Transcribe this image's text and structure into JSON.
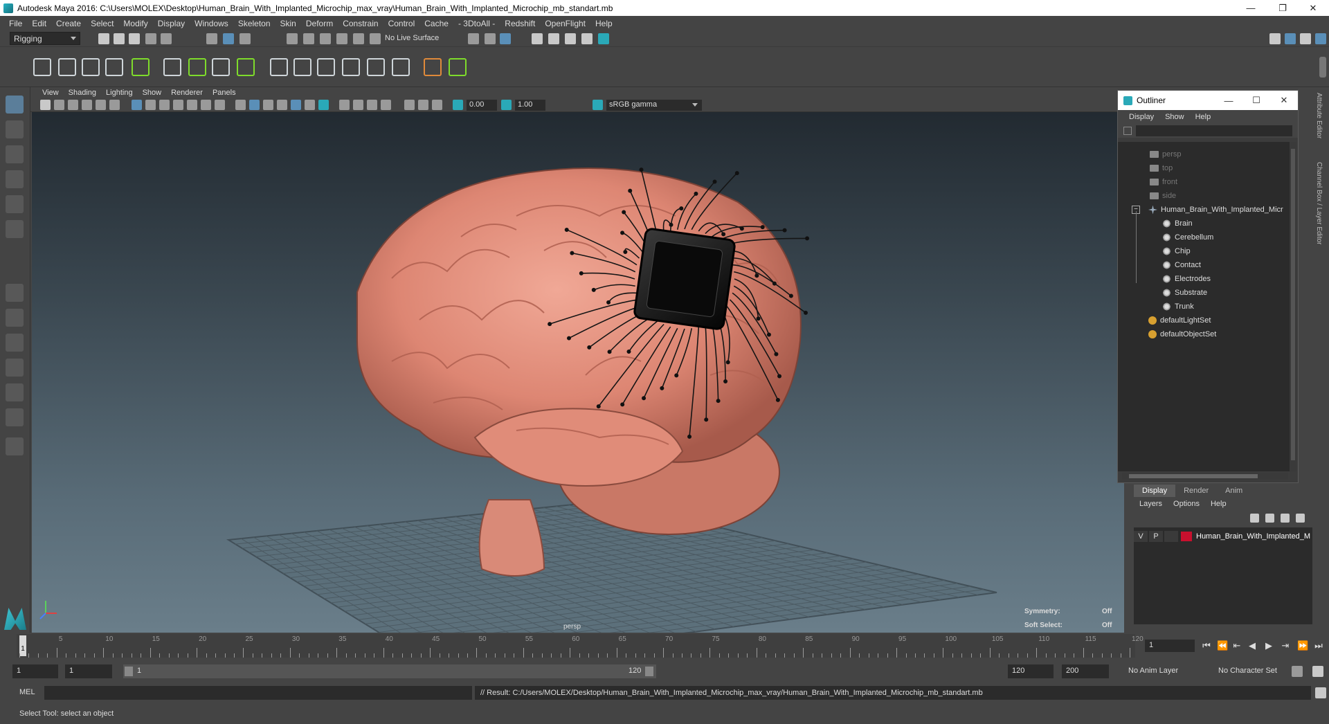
{
  "window": {
    "title": "Autodesk Maya 2016: C:\\Users\\MOLEX\\Desktop\\Human_Brain_With_Implanted_Microchip_max_vray\\Human_Brain_With_Implanted_Microchip_mb_standart.mb",
    "minimize": "—",
    "restore": "❐",
    "close": "✕"
  },
  "menubar": [
    "File",
    "Edit",
    "Create",
    "Select",
    "Modify",
    "Display",
    "Windows",
    "Skeleton",
    "Skin",
    "Deform",
    "Constrain",
    "Control",
    "Cache",
    "- 3DtoAll -",
    "Redshift",
    "OpenFlight",
    "Help"
  ],
  "status_line": {
    "mode": "Rigging",
    "live_surface": "No Live Surface"
  },
  "viewport": {
    "menus": [
      "View",
      "Shading",
      "Lighting",
      "Show",
      "Renderer",
      "Panels"
    ],
    "exposure": "0.00",
    "gamma_value": "1.00",
    "color_space": "sRGB gamma",
    "camera_label": "persp",
    "hud": {
      "symmetry_label": "Symmetry:",
      "symmetry_value": "Off",
      "soft_select_label": "Soft Select:",
      "soft_select_value": "Off"
    }
  },
  "outliner": {
    "title": "Outliner",
    "menus": [
      "Display",
      "Show",
      "Help"
    ],
    "cameras": [
      "persp",
      "top",
      "front",
      "side"
    ],
    "group": "Human_Brain_With_Implanted_Micr",
    "children": [
      "Brain",
      "Cerebellum",
      "Chip",
      "Contact",
      "Electrodes",
      "Substrate",
      "Trunk"
    ],
    "sets": [
      "defaultLightSet",
      "defaultObjectSet"
    ]
  },
  "right_strip": {
    "attribute_editor": "Attribute Editor",
    "channel_box": "Channel Box / Layer Editor"
  },
  "layer_editor": {
    "tabs": [
      "Display",
      "Render",
      "Anim"
    ],
    "active_tab": "Display",
    "menus": [
      "Layers",
      "Options",
      "Help"
    ],
    "layer": {
      "visible": "V",
      "playback": "P",
      "name": "Human_Brain_With_Implanted_M",
      "color": "#c8102e"
    }
  },
  "timeline": {
    "ticks": [
      5,
      10,
      15,
      20,
      25,
      30,
      35,
      40,
      45,
      50,
      55,
      60,
      65,
      70,
      75,
      80,
      85,
      90,
      95,
      100,
      105,
      110,
      115,
      120
    ],
    "current_marker": "1",
    "current_frame": "1",
    "range_start": 1,
    "range_end": 120
  },
  "range_bar": {
    "start_frame": "1",
    "playback_start": "1",
    "slider_start": "1",
    "slider_end": "120",
    "playback_end": "120",
    "end_frame": "200",
    "anim_layer": "No Anim Layer",
    "character_set": "No Character Set"
  },
  "command_line": {
    "label": "MEL",
    "result": "// Result: C:/Users/MOLEX/Desktop/Human_Brain_With_Implanted_Microchip_max_vray/Human_Brain_With_Implanted_Microchip_mb_standart.mb"
  },
  "help_line": "Select Tool: select an object"
}
